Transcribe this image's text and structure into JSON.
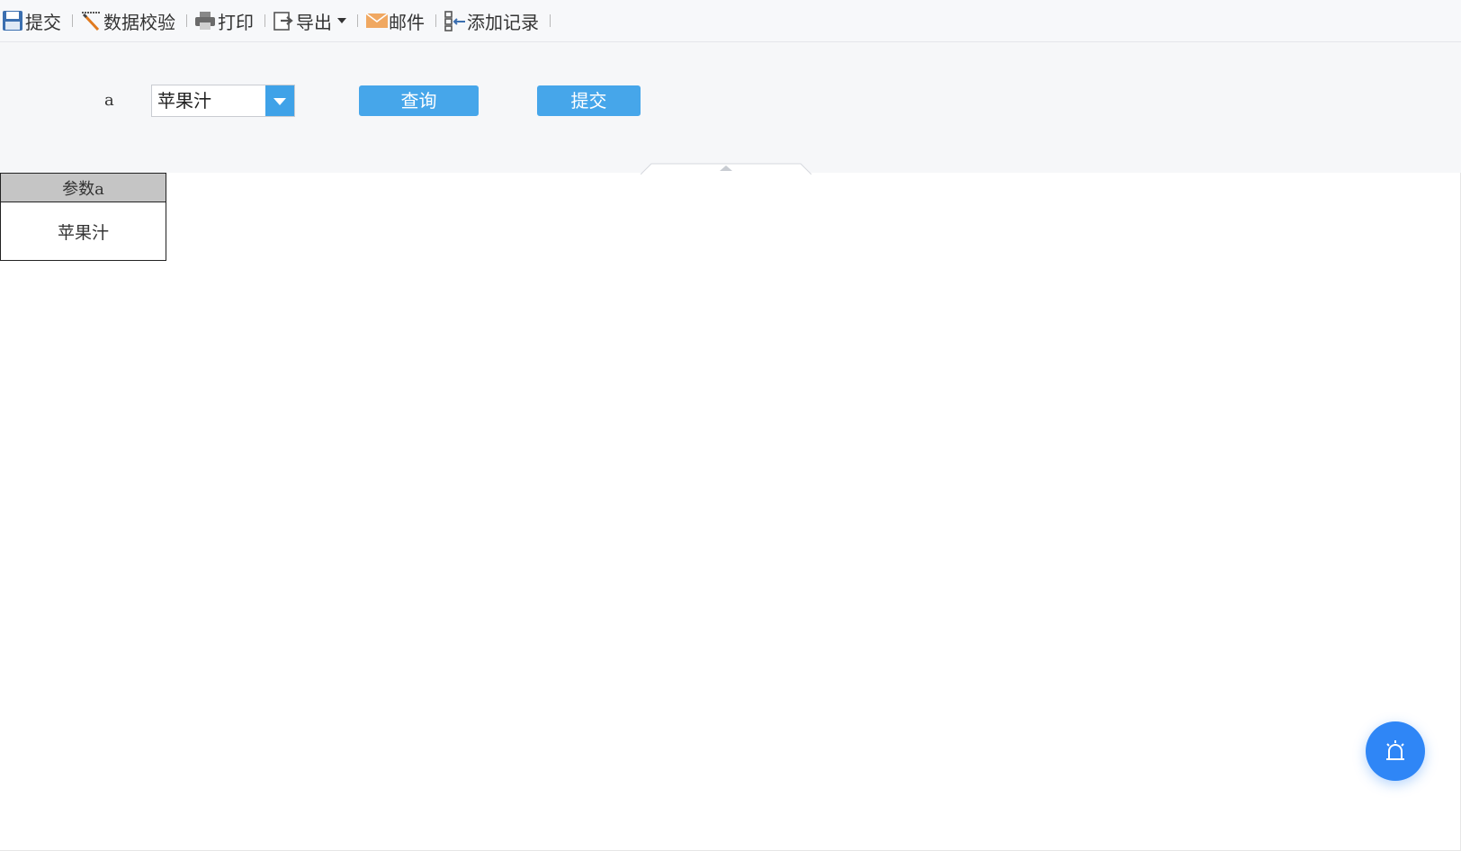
{
  "toolbar": {
    "items": [
      {
        "label": "提交",
        "icon": "save-icon"
      },
      {
        "label": "数据校验",
        "icon": "data-check-icon"
      },
      {
        "label": "打印",
        "icon": "printer-icon"
      },
      {
        "label": "导出",
        "icon": "export-icon"
      },
      {
        "label": "邮件",
        "icon": "mail-icon"
      },
      {
        "label": "添加记录",
        "icon": "add-record-icon"
      }
    ]
  },
  "params": {
    "label": "a",
    "selected_value": "苹果汁",
    "query_button": "查询",
    "submit_button": "提交"
  },
  "report": {
    "header": "参数a",
    "cell": "苹果汁"
  },
  "colors": {
    "accent": "#46a6ea",
    "fab": "#2f86f6",
    "header_bg": "#c5c5c5"
  }
}
